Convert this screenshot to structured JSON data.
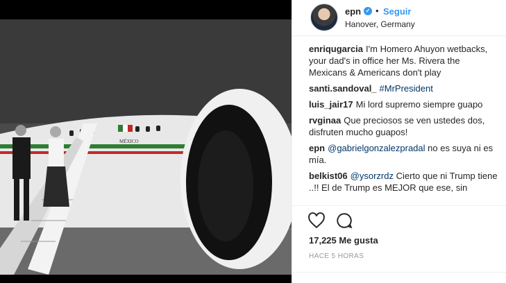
{
  "post": {
    "username": "epn",
    "follow_label": "Seguir",
    "separator": "•",
    "location": "Hanover, Germany",
    "photo_text": {
      "plane_label": "MÉXICO",
      "flag_colors": [
        "#2e7d32",
        "#ffffff",
        "#c62828"
      ]
    }
  },
  "comments": [
    {
      "user": "enriqugarcia",
      "text": "I'm Homero Ahuyon wetbacks, your dad's in office her Ms. Rivera the Mexicans & Americans don't play"
    },
    {
      "user": "santi.sandoval_",
      "link": "#MrPresident",
      "text": ""
    },
    {
      "user": "luis_jair17",
      "text": "Mi lord supremo siempre guapo"
    },
    {
      "user": "rvginaa",
      "text": "Que preciosos se ven ustedes dos, disfruten mucho guapos!"
    },
    {
      "user": "epn",
      "link": "@gabrielgonzalezpradal",
      "text": " no es suya ni es mía."
    },
    {
      "user": "belkist06",
      "link": "@ysorzrdz",
      "text": " Cierto que ni Trump tiene ..!! El de Trump es MEJOR que ese, sin"
    }
  ],
  "stats": {
    "likes": "17,225 Me gusta",
    "timestamp": "HACE 5 HORAS"
  },
  "icons": [
    "verified-badge-icon",
    "heart-icon",
    "comment-icon"
  ],
  "colors": {
    "link": "#003569",
    "follow": "#3897f0",
    "verified": "#3897f0"
  }
}
